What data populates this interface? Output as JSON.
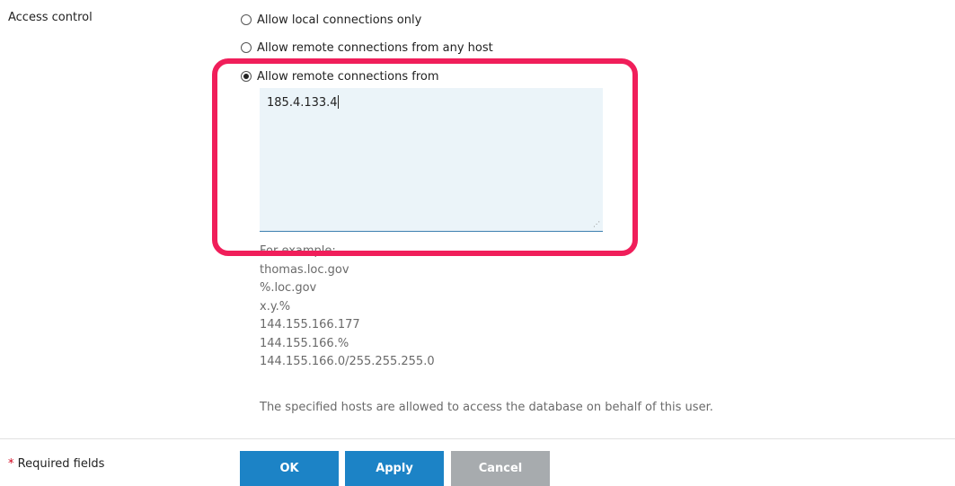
{
  "access_control": {
    "label": "Access control",
    "options": [
      {
        "label": "Allow local connections only",
        "checked": false
      },
      {
        "label": "Allow remote connections from any host",
        "checked": false
      },
      {
        "label": "Allow remote connections from",
        "checked": true
      }
    ],
    "hosts_value": "185.4.133.4"
  },
  "examples": {
    "heading": "For example:",
    "items": [
      "thomas.loc.gov",
      "%.loc.gov",
      "x.y.%",
      "144.155.166.177",
      "144.155.166.%",
      "144.155.166.0/255.255.255.0"
    ]
  },
  "hint": "The specified hosts are allowed to access the database on behalf of this user.",
  "footer": {
    "required_star": "*",
    "required_label": "Required fields",
    "ok_label": "OK",
    "apply_label": "Apply",
    "cancel_label": "Cancel"
  },
  "colors": {
    "primary_button": "#1c83c6",
    "cancel_button": "#a7abae",
    "highlight": "#f01e5a",
    "textarea_bg": "#ebf4f9"
  }
}
